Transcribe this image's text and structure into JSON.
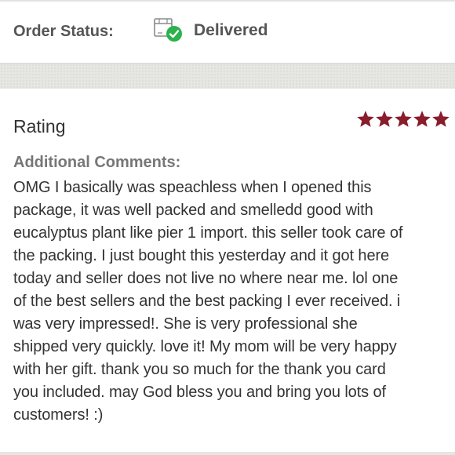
{
  "order": {
    "status_label": "Order Status:",
    "status_value": "Delivered",
    "status_icon": "package-delivered-icon",
    "check_color": "#2bb24c"
  },
  "rating": {
    "title": "Rating",
    "stars": 5,
    "max_stars": 5,
    "star_color": "#8a1c2b"
  },
  "comments": {
    "label": "Additional Comments:",
    "lines": [
      "OMG I basically was speachless when I opened this",
      "package, it was well packed and smelledd good with",
      "eucalyptus plant like pier 1 import. this seller took care of",
      "the packing. I just bought this yesterday and it got here",
      "today and seller does not live no where near me. lol one",
      "of the best sellers and the best packing I ever received. i",
      "was very impressed!. She is very professional she",
      "shipped very quickly. love it! My mom will be very happy",
      "with her gift. thank you so much for the thank you card",
      "you included. may God bless you and bring you lots of",
      "customers! :)"
    ]
  }
}
